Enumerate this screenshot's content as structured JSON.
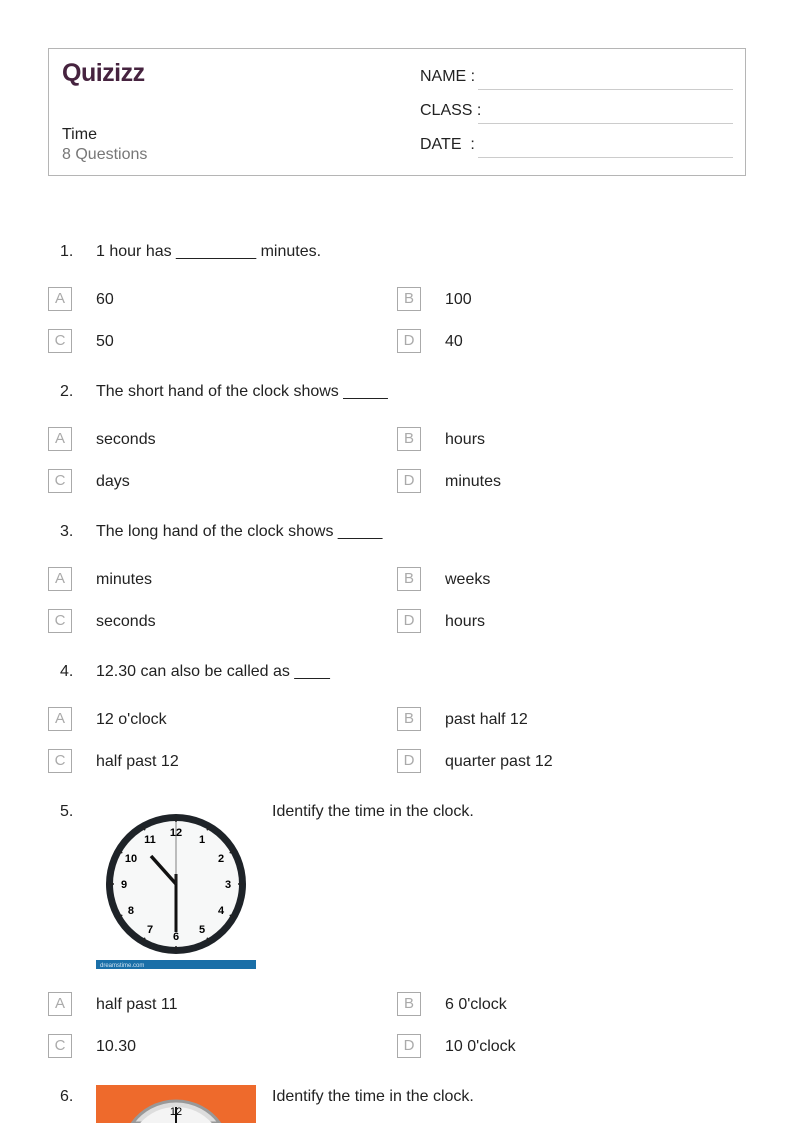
{
  "header": {
    "logo": "Quizizz",
    "title": "Time",
    "subtitle": "8 Questions",
    "fields": [
      "NAME :",
      "CLASS :",
      "DATE  :"
    ]
  },
  "questions": [
    {
      "number": "1.",
      "text": "1 hour has _________ minutes.",
      "options": [
        {
          "letter": "A",
          "text": "60"
        },
        {
          "letter": "B",
          "text": "100"
        },
        {
          "letter": "C",
          "text": "50"
        },
        {
          "letter": "D",
          "text": "40"
        }
      ]
    },
    {
      "number": "2.",
      "text": "The short hand of the clock shows _____",
      "options": [
        {
          "letter": "A",
          "text": "seconds"
        },
        {
          "letter": "B",
          "text": "hours"
        },
        {
          "letter": "C",
          "text": "days"
        },
        {
          "letter": "D",
          "text": "minutes"
        }
      ]
    },
    {
      "number": "3.",
      "text": "The long hand of the clock shows _____",
      "options": [
        {
          "letter": "A",
          "text": "minutes"
        },
        {
          "letter": "B",
          "text": "weeks"
        },
        {
          "letter": "C",
          "text": "seconds"
        },
        {
          "letter": "D",
          "text": "hours"
        }
      ]
    },
    {
      "number": "4.",
      "text": "12.30 can also be called as ____",
      "options": [
        {
          "letter": "A",
          "text": "12 o'clock"
        },
        {
          "letter": "B",
          "text": "past half 12"
        },
        {
          "letter": "C",
          "text": "half past 12"
        },
        {
          "letter": "D",
          "text": "quarter past 12"
        }
      ]
    },
    {
      "number": "5.",
      "text": "Identify the time in the clock.",
      "image_caption": "dreamstime.com",
      "options": [
        {
          "letter": "A",
          "text": "half past 11"
        },
        {
          "letter": "B",
          "text": "6 0'clock"
        },
        {
          "letter": "C",
          "text": "10.30"
        },
        {
          "letter": "D",
          "text": "10 0'clock"
        }
      ]
    },
    {
      "number": "6.",
      "text": "Identify the time in the clock."
    }
  ]
}
